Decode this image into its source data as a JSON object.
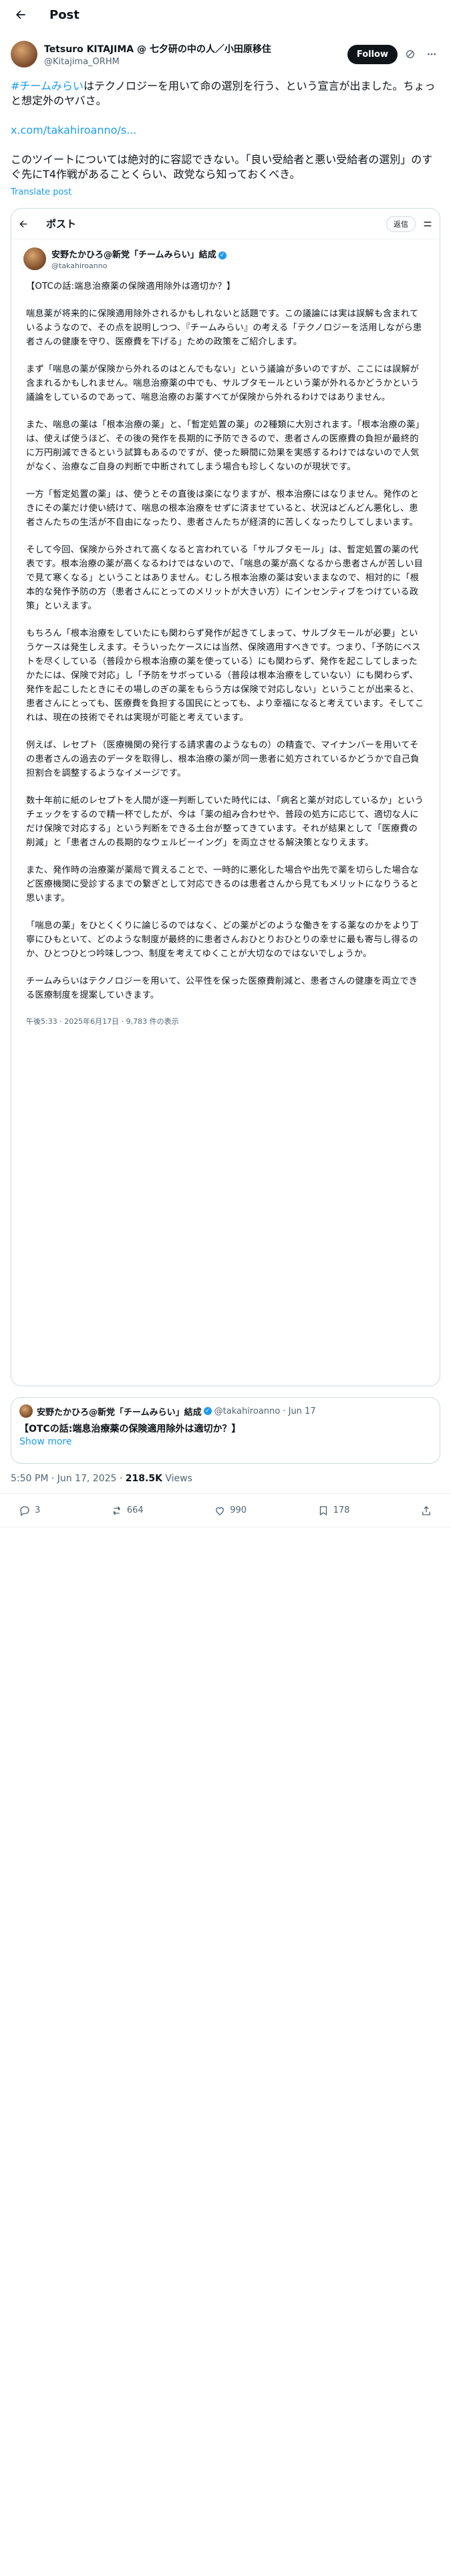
{
  "header": {
    "title": "Post"
  },
  "author": {
    "name": "Tetsuro KITAJIMA @ 七夕研の中の人／小田原移住",
    "handle": "@Kitajima_ORHM",
    "follow_label": "Follow"
  },
  "post": {
    "hashtag": "#チームみらい",
    "line1_rest": "はテクノロジーを用いて命の選別を行う、という宣言が出ました。ちょっと想定外のヤバさ。",
    "link": "x.com/takahiroanno/s...",
    "para2": "このツイートについては絶対的に容認できない。「良い受給者と悪い受給者の選別」のすぐ先にT4作戦があることくらい、政党なら知っておくべき。",
    "translate": "Translate post"
  },
  "screenshot": {
    "title": "ポスト",
    "reply_label": "返信",
    "author_name": "安野たかひろ@新党「チームみらい」結成",
    "author_handle": "@takahiroanno",
    "paragraphs": [
      "【OTCの話:端息治療薬の保険適用除外は適切か？】",
      "喘息薬が将来的に保険適用除外されるかもしれないと話題です。この議論には実は誤解も含まれているようなので、その点を説明しつつ、『チームみらい』の考える「テクノロジーを活用しながら患者さんの健康を守り、医療費を下げる」ための政策をご紹介します。",
      "まず「喘息の薬が保険から外れるのはとんでもない」という議論が多いのですが、ここには誤解が含まれるかもしれません。喘息治療薬の中でも、サルブタモールという薬が外れるかどうかという議論をしているのであって、喘息治療のお薬すべてが保険から外れるわけではありません。",
      "また、喘息の薬は「根本治療の薬」と、「暫定処置の薬」の2種類に大別されます。「根本治療の薬」は、使えば使うほど、その後の発作を長期的に予防できるので、患者さんの医療費の負担が最終的に万円削減できるという試算もあるのですが、使った瞬間に効果を実感するわけではないので人気がなく、治療なご自身の判断で中断されてしまう場合も珍しくないのが現状です。",
      "一方「暫定処置の薬」は、使うとその直後は楽になりますが、根本治療にはなりません。発作のときにその薬だけ使い続けて、喘息の根本治療をせずに済ませていると、状況はどんどん悪化し、患者さんたちの生活が不自由になったり、患者さんたちが経済的に苦しくなったりしてしまいます。",
      "そして今回、保険から外されて高くなると言われている「サルブタモール」は、暫定処置の薬の代表です。根本治療の薬が高くなるわけではないので、「喘息の薬が高くなるから患者さんが苦しい目で見て寒くなる」ということはありません。むしろ根本治療の薬は安いままなので、相対的に「根本的な発作予防の方（患者さんにとってのメリットが大きい方）にインセンティブをつけている政策」といえます。",
      "もちろん「根本治療をしていたにも関わらず発作が起きてしまって、サルブタモールが必要」というケースは発生しえます。そういったケースには当然、保険適用すべきです。つまり、「予防にベストを尽くしている（普段から根本治療の薬を使っている）にも関わらず、発作を起こしてしまったかたには、保険で対応」し「予防をサボっている（普段は根本治療をしていない）にも関わらず、発作を起こしたときにその場しのぎの薬をもらう方は保険で対応しない」ということが出来ると、患者さんにとっても、医療費を負担する国民にとっても、より幸福になると考えています。そしてこれは、現在の技術でそれは実現が可能と考えています。",
      "例えば、レセプト（医療機関の発行する請求書のようなもの）の精査で、マイナンバーを用いてその患者さんの過去のデータを取得し、根本治療の薬が同一患者に処方されているかどうかで自己負担割合を調整するようなイメージです。",
      "数十年前に紙のレセプトを人間が逐一判断していた時代には、「病名と薬が対応しているか」というチェックをするので精一杯でしたが、今は「薬の組み合わせや、普段の処方に応じて、適切な人にだけ保険で対応する」という判断をできる土台が整ってきています。それが結果として「医療費の削減」と「患者さんの長期的なウェルビーイング」を両立させる解決策となりえます。",
      "また、発作時の治療薬が薬局で買えることで、一時的に悪化した場合や出先で薬を切らした場合など医療機関に受診するまでの繋ぎとして対応できるのは患者さんから見てもメリットになりうると思います。",
      "「喘息の薬」をひとくくりに論じるのではなく、どの薬がどのような働きをする薬なのかをより丁寧にひもといて、どのような制度が最終的に患者さんおひとりおひとりの幸せに最も寄与し得るのか、ひとつひとつ吟味しつつ、制度を考えてゆくことが大切なのではないでしょうか。",
      "チームみらいはテクノロジーを用いて、公平性を保った医療費削減と、患者さんの健康を両立できる医療制度を提案していきます。"
    ],
    "meta": "午後5:33 · 2025年6月17日 · 9,783 件の表示"
  },
  "quote": {
    "author_name": "安野たかひろ@新党「チームみらい」結成",
    "author_handle": "@takahiroanno · Jun 17",
    "text": "【OTCの話:端息治療薬の保険適用除外は適切か？】",
    "show_more": "Show more"
  },
  "meta": {
    "time": "5:50 PM · Jun 17, 2025 · ",
    "views": "218.5K",
    "views_label": " Views"
  },
  "actions": {
    "replies": "3",
    "reposts": "664",
    "likes": "990",
    "bookmarks": "178"
  },
  "icons": [
    "back-arrow-icon",
    "grok-icon",
    "more-icon",
    "reply-icon",
    "repost-icon",
    "like-icon",
    "bookmark-icon",
    "share-icon",
    "verified-badge-icon"
  ]
}
